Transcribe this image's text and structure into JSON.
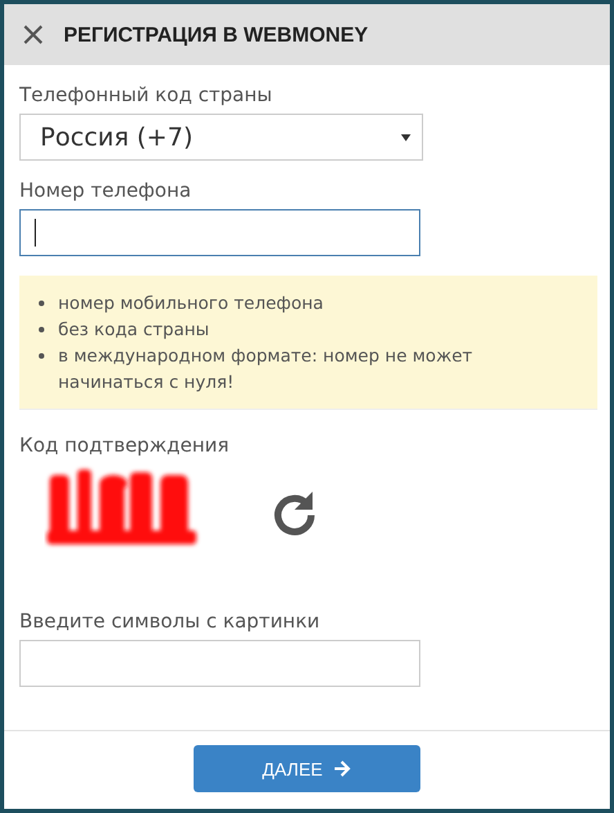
{
  "dialog": {
    "title": "РЕГИСТРАЦИЯ В WEBMONEY"
  },
  "fields": [
    {
      "kind": "select",
      "label": "Телефонный код страны",
      "value": "Россия (+7)"
    },
    {
      "kind": "text",
      "label": "Номер телефона",
      "focused": true
    }
  ],
  "hints": [
    "номер мобильного телефона",
    "без кода страны",
    "в международном формате: номер не может начинаться с нуля!"
  ],
  "captcha": {
    "label": "Код подтверждения"
  },
  "code_field": {
    "label": "Введите символы с картинки",
    "focused": false
  },
  "button": {
    "label": "ДАЛЕЕ"
  }
}
